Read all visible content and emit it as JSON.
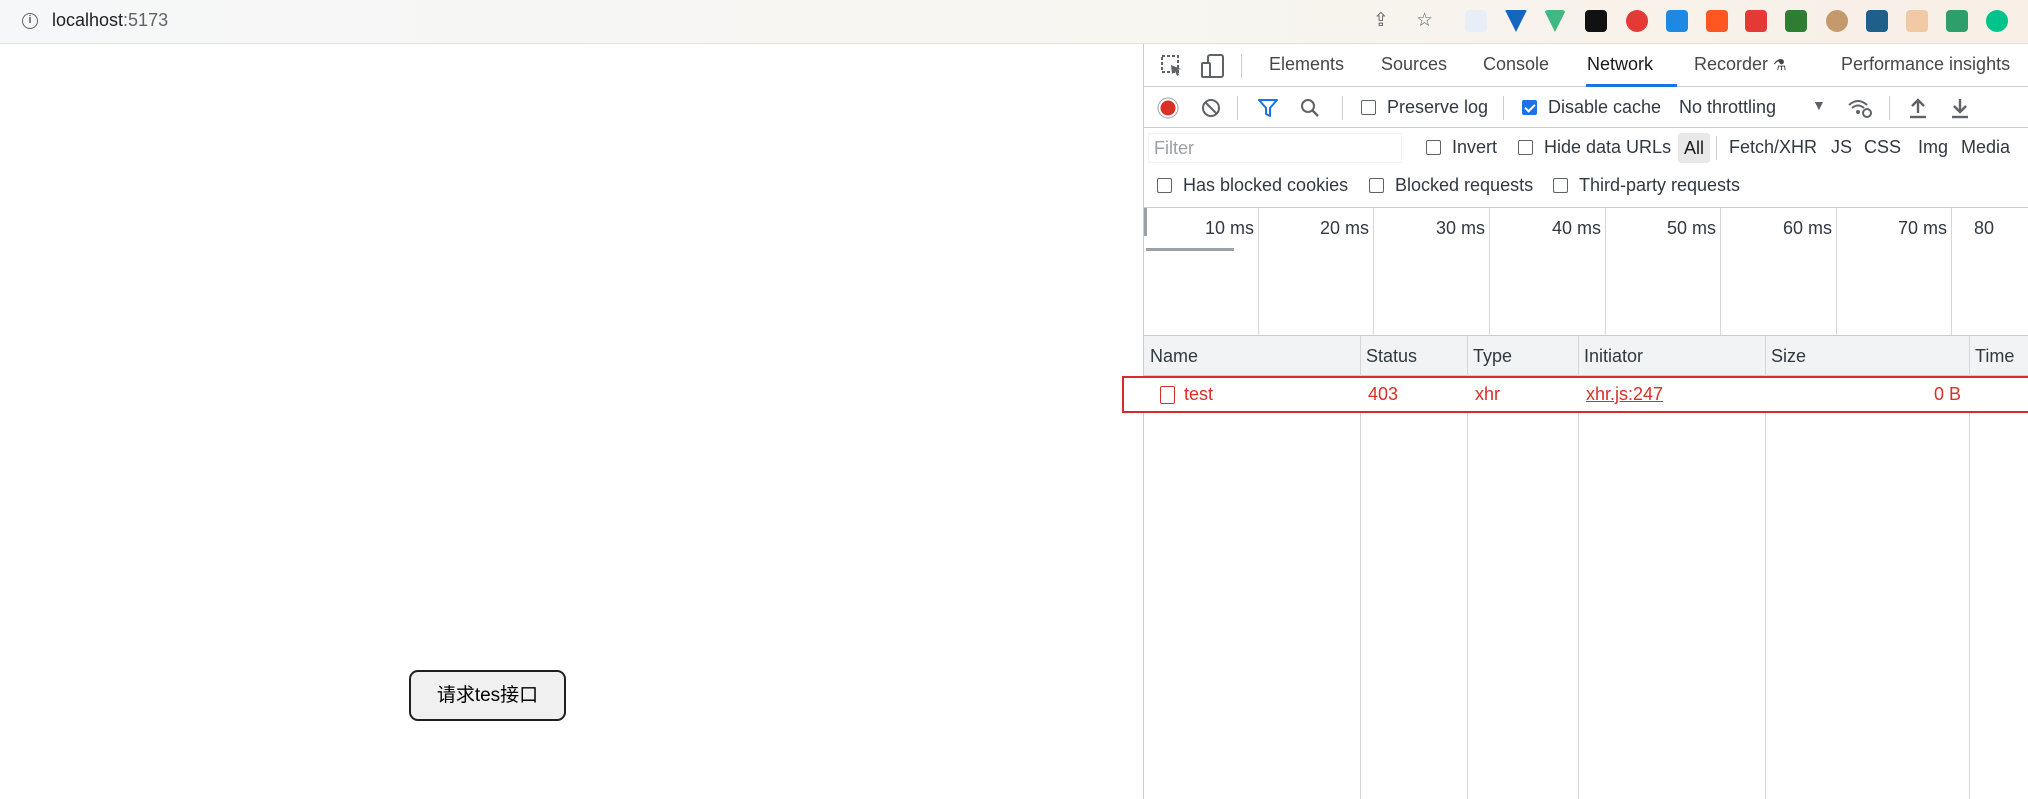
{
  "browser": {
    "url_host": "localhost",
    "url_port": ":5173"
  },
  "page": {
    "button_label": "请求tes接口"
  },
  "devtools": {
    "tabs": [
      "Elements",
      "Sources",
      "Console",
      "Network",
      "Recorder",
      "Performance insights"
    ],
    "active_tab": "Network",
    "toolbar": {
      "preserve_log": {
        "label": "Preserve log",
        "checked": false
      },
      "disable_cache": {
        "label": "Disable cache",
        "checked": true
      },
      "throttling": "No throttling"
    },
    "filter": {
      "placeholder": "Filter",
      "invert_label": "Invert",
      "hide_data_urls_label": "Hide data URLs",
      "types": [
        "All",
        "Fetch/XHR",
        "JS",
        "CSS",
        "Img",
        "Media"
      ],
      "has_blocked_cookies": "Has blocked cookies",
      "blocked_requests": "Blocked requests",
      "third_party_requests": "Third-party requests"
    },
    "timeline_ticks": [
      "10 ms",
      "20 ms",
      "30 ms",
      "40 ms",
      "50 ms",
      "60 ms",
      "70 ms",
      "80"
    ],
    "table": {
      "columns": [
        "Name",
        "Status",
        "Type",
        "Initiator",
        "Size",
        "Time"
      ],
      "rows": [
        {
          "name": "test",
          "status": "403",
          "type": "xhr",
          "initiator": "xhr.js:247",
          "size": "0 B",
          "time": ""
        }
      ]
    }
  },
  "colors": {
    "accent": "#1a73e8",
    "error": "#d93025",
    "record": "#d93025"
  }
}
